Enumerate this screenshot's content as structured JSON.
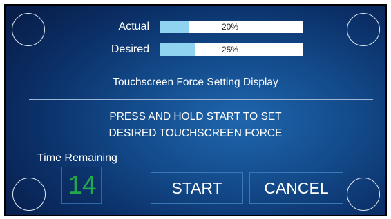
{
  "bars": {
    "actual": {
      "label": "Actual",
      "value_text": "20%",
      "fraction": 0.2
    },
    "desired": {
      "label": "Desired",
      "value_text": "25%",
      "fraction": 0.25
    }
  },
  "title": "Touchscreen Force Setting Display",
  "instructions": {
    "line1": "PRESS AND HOLD START TO SET",
    "line2": "DESIRED TOUCHSCREEN FORCE"
  },
  "timer": {
    "label": "Time Remaining",
    "value": "14"
  },
  "buttons": {
    "start": "START",
    "cancel": "CANCEL"
  },
  "colors": {
    "background": "#134a8a",
    "bar_fill": "#8fd3f1",
    "timer_digits": "#25a84c",
    "text": "#ffffff"
  }
}
